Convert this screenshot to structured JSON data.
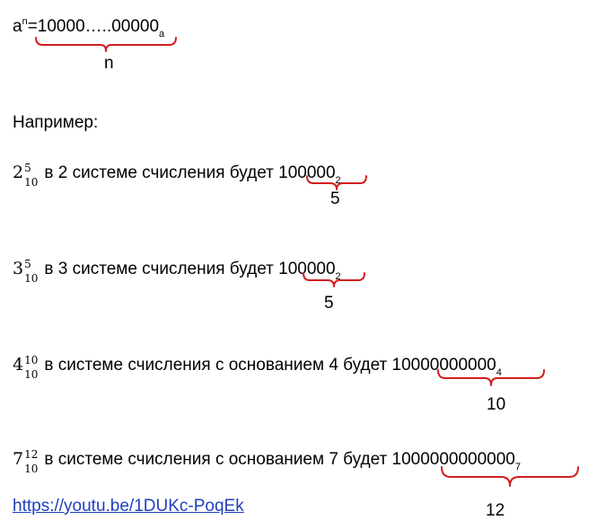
{
  "header": {
    "base": "a",
    "exp": "n",
    "equals_number": "=10000…..00000",
    "base_sub": "a",
    "brace_label": "n"
  },
  "intro_text": "Например:",
  "examples": [
    {
      "base": "2",
      "sup": "5",
      "sub": "10",
      "text": " в 2 системе счисления будет 100000",
      "result_sub": "2",
      "brace_label": "5"
    },
    {
      "base": "3",
      "sup": "5",
      "sub": "10",
      "text": " в 3 системе счисления будет 100000",
      "result_sub": "2",
      "brace_label": "5"
    },
    {
      "base": "4",
      "sup": "10",
      "sub": "10",
      "text": " в системе счисления с основанием 4 будет 10000000000",
      "result_sub": "4",
      "brace_label": "10"
    },
    {
      "base": "7",
      "sup": "12",
      "sub": "10",
      "text": " в системе счисления с основанием 7 будет 1000000000000",
      "result_sub": "7",
      "brace_label": "12"
    }
  ],
  "link_text": "https://youtu.be/1DUKc-PoqEk",
  "colors": {
    "brace": "#d21f1f",
    "link": "#1f3fbf"
  }
}
